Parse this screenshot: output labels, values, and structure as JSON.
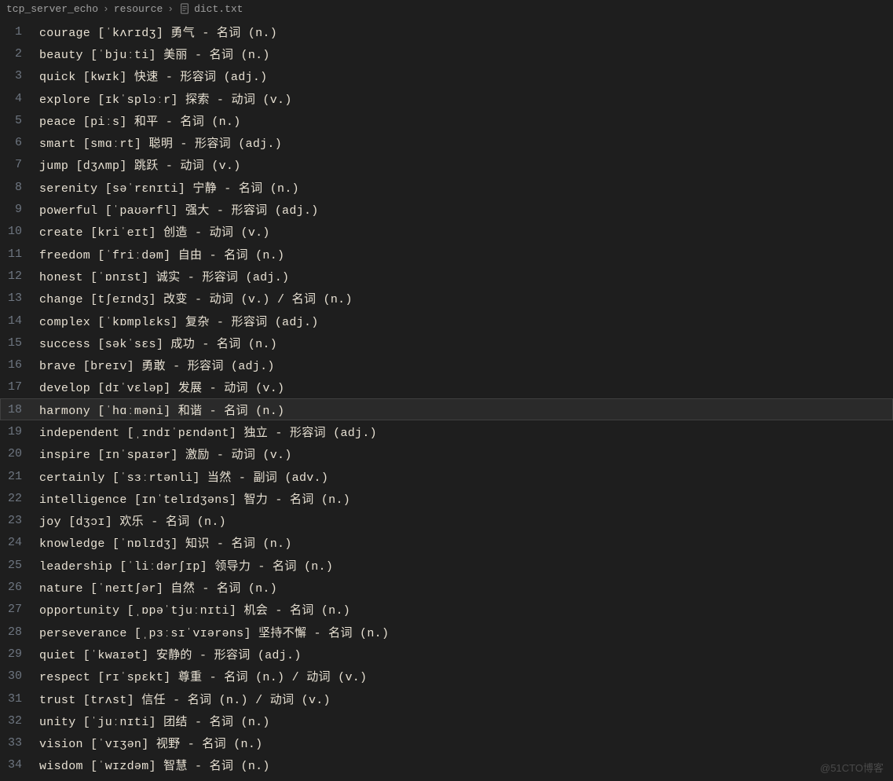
{
  "breadcrumb": {
    "parts": [
      "tcp_server_echo",
      "resource",
      "dict.txt"
    ]
  },
  "highlighted_line": 18,
  "lines": [
    {
      "n": 1,
      "text": "courage [ˈkʌrɪdʒ] 勇气 - 名词 (n.)"
    },
    {
      "n": 2,
      "text": "beauty [ˈbjuːti] 美丽 - 名词 (n.)"
    },
    {
      "n": 3,
      "text": "quick [kwɪk] 快速 - 形容词 (adj.)"
    },
    {
      "n": 4,
      "text": "explore [ɪkˈsplɔːr] 探索 - 动词 (v.)"
    },
    {
      "n": 5,
      "text": "peace [piːs] 和平 - 名词 (n.)"
    },
    {
      "n": 6,
      "text": "smart [smɑːrt] 聪明 - 形容词 (adj.)"
    },
    {
      "n": 7,
      "text": "jump [dʒʌmp] 跳跃 - 动词 (v.)"
    },
    {
      "n": 8,
      "text": "serenity [səˈrɛnɪti] 宁静 - 名词 (n.)"
    },
    {
      "n": 9,
      "text": "powerful [ˈpaʊərfl] 强大 - 形容词 (adj.)"
    },
    {
      "n": 10,
      "text": "create [kriˈeɪt] 创造 - 动词 (v.)"
    },
    {
      "n": 11,
      "text": "freedom [ˈfriːdəm] 自由 - 名词 (n.)"
    },
    {
      "n": 12,
      "text": "honest [ˈɒnɪst] 诚实 - 形容词 (adj.)"
    },
    {
      "n": 13,
      "text": "change [tʃeɪndʒ] 改变 - 动词 (v.) / 名词 (n.)"
    },
    {
      "n": 14,
      "text": "complex [ˈkɒmplɛks] 复杂 - 形容词 (adj.)"
    },
    {
      "n": 15,
      "text": "success [səkˈsɛs] 成功 - 名词 (n.)"
    },
    {
      "n": 16,
      "text": "brave [breɪv] 勇敢 - 形容词 (adj.)"
    },
    {
      "n": 17,
      "text": "develop [dɪˈvɛləp] 发展 - 动词 (v.)"
    },
    {
      "n": 18,
      "text": "harmony [ˈhɑːməni] 和谐 - 名词 (n.)"
    },
    {
      "n": 19,
      "text": "independent [ˌɪndɪˈpɛndənt] 独立 - 形容词 (adj.)"
    },
    {
      "n": 20,
      "text": "inspire [ɪnˈspaɪər] 激励 - 动词 (v.)"
    },
    {
      "n": 21,
      "text": "certainly [ˈsɜːrtənli] 当然 - 副词 (adv.)"
    },
    {
      "n": 22,
      "text": "intelligence [ɪnˈtelɪdʒəns] 智力 - 名词 (n.)"
    },
    {
      "n": 23,
      "text": "joy [dʒɔɪ] 欢乐 - 名词 (n.)"
    },
    {
      "n": 24,
      "text": "knowledge [ˈnɒlɪdʒ] 知识 - 名词 (n.)"
    },
    {
      "n": 25,
      "text": "leadership [ˈliːdərʃɪp] 领导力 - 名词 (n.)"
    },
    {
      "n": 26,
      "text": "nature [ˈneɪtʃər] 自然 - 名词 (n.)"
    },
    {
      "n": 27,
      "text": "opportunity [ˌɒpəˈtjuːnɪti] 机会 - 名词 (n.)"
    },
    {
      "n": 28,
      "text": "perseverance [ˌpɜːsɪˈvɪərəns] 坚持不懈 - 名词 (n.)"
    },
    {
      "n": 29,
      "text": "quiet [ˈkwaɪət] 安静的 - 形容词 (adj.)"
    },
    {
      "n": 30,
      "text": "respect [rɪˈspɛkt] 尊重 - 名词 (n.) / 动词 (v.)"
    },
    {
      "n": 31,
      "text": "trust [trʌst] 信任 - 名词 (n.) / 动词 (v.)"
    },
    {
      "n": 32,
      "text": "unity [ˈjuːnɪti] 团结 - 名词 (n.)"
    },
    {
      "n": 33,
      "text": "vision [ˈvɪʒən] 视野 - 名词 (n.)"
    },
    {
      "n": 34,
      "text": "wisdom [ˈwɪzdəm] 智慧 - 名词 (n.)"
    }
  ],
  "watermark": "@51CTO博客"
}
